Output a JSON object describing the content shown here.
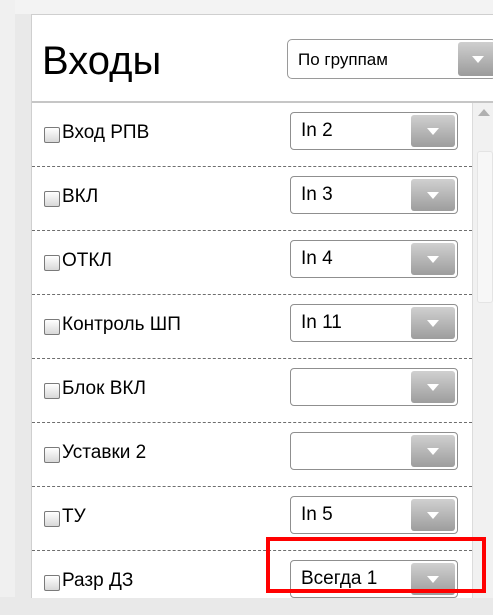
{
  "header": {
    "title": "Входы",
    "group_select": {
      "value": "По группам"
    }
  },
  "rows": [
    {
      "label": "Вход РПВ",
      "checked": false,
      "value": "In 2"
    },
    {
      "label": "ВКЛ",
      "checked": false,
      "value": "In 3"
    },
    {
      "label": "ОТКЛ",
      "checked": false,
      "value": "In 4"
    },
    {
      "label": "Контроль ШП",
      "checked": false,
      "value": "In 11"
    },
    {
      "label": "Блок ВКЛ",
      "checked": false,
      "value": ""
    },
    {
      "label": "Уставки 2",
      "checked": false,
      "value": ""
    },
    {
      "label": "ТУ",
      "checked": false,
      "value": "In 5"
    },
    {
      "label": "Разр ДЗ",
      "checked": false,
      "value": "Всегда 1"
    }
  ],
  "colors": {
    "highlight": "#ff0000",
    "dropdown_button": "#9d9d9d"
  },
  "icons": {
    "dropdown": "chevron-down-icon",
    "scroll_up": "arrow-up-icon"
  }
}
